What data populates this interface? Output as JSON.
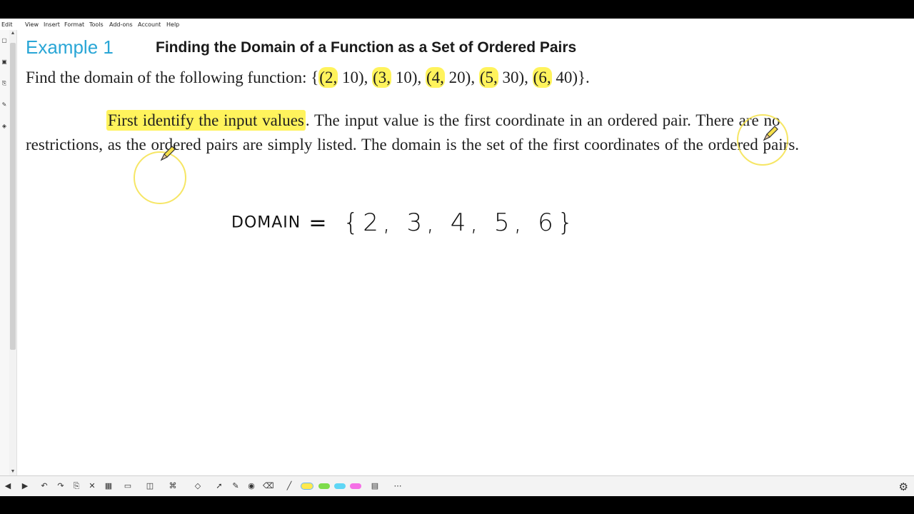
{
  "menu": [
    "Edit",
    "View",
    "Insert",
    "Format",
    "Tools",
    "Add-ons",
    "Account",
    "Help"
  ],
  "example": {
    "label": "Example 1",
    "title": "Finding the Domain of a Function as a Set of Ordered Pairs"
  },
  "problem": {
    "prefix": "Find the domain of the following function: {",
    "pairs": [
      {
        "first": "(2,",
        "rest": " 10)"
      },
      {
        "first": "(3,",
        "rest": " 10)"
      },
      {
        "first": "(4,",
        "rest": " 20)"
      },
      {
        "first": "(5,",
        "rest": " 30)"
      },
      {
        "first": "(6,",
        "rest": " 40)"
      }
    ],
    "separator": ", ",
    "suffix": "}."
  },
  "explanation": {
    "highlighted": "First identify the input values",
    "line1_rest": ". The input value is the first coordinate in an ordered pair. There are no",
    "line2": "restrictions, as the ordered pairs are simply listed. The domain is the set of the first coordinates of the ordered pairs."
  },
  "handwriting": {
    "word": "DOMAIN",
    "equals": "=",
    "set": "{2, 3, 4, 5, 6}"
  },
  "colors": {
    "example_label": "#29a6d6",
    "highlight": "#fff35c",
    "cursor_ring": "#f4e24a"
  },
  "pen_colors": [
    "#ffe94d",
    "#7ddc4a",
    "#5fd6f5",
    "#f56fe6"
  ]
}
